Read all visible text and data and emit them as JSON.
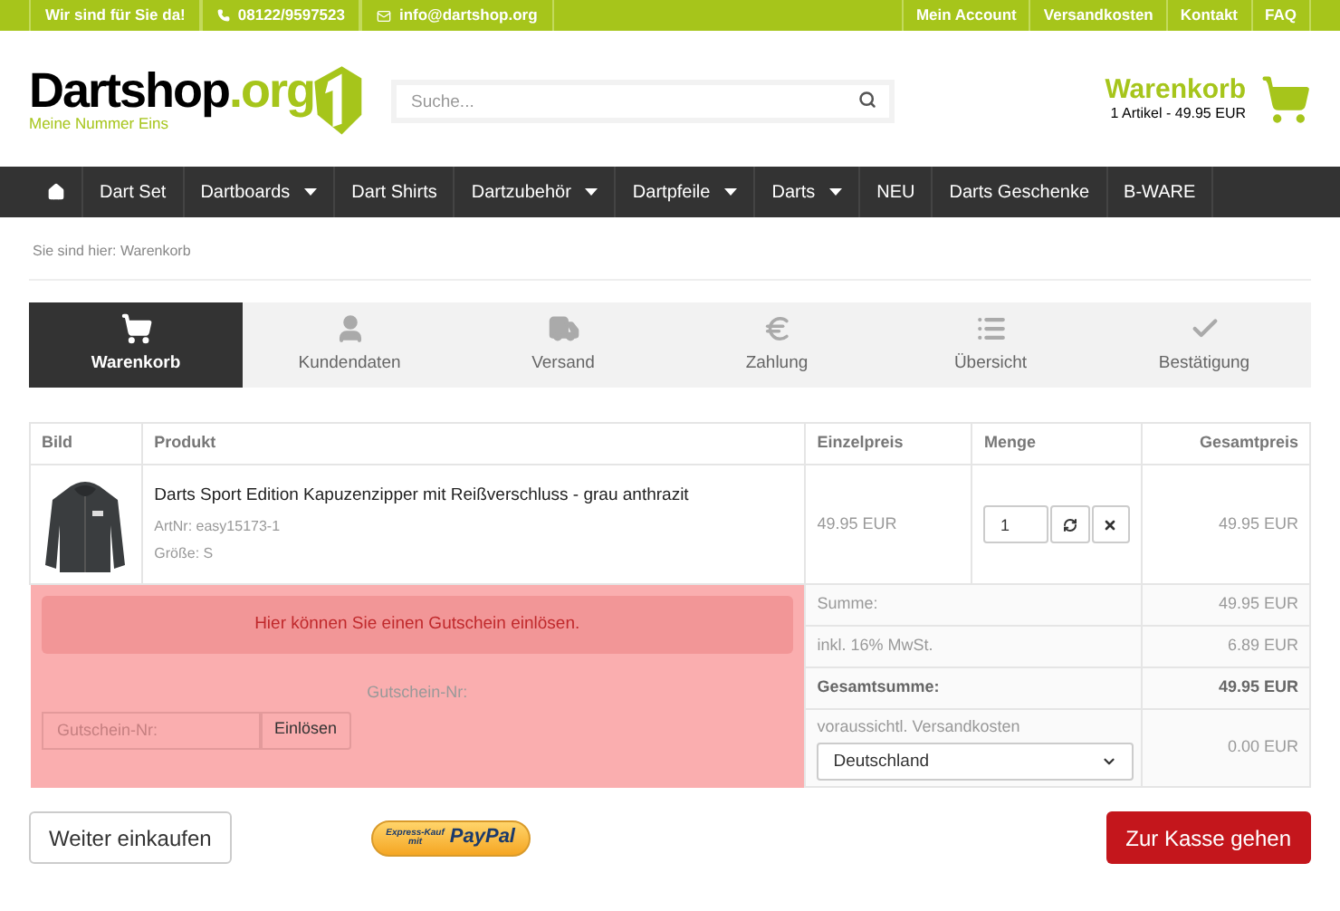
{
  "top_bar": {
    "left": [
      {
        "kind": "plain",
        "label": "Wir sind für Sie da!"
      },
      {
        "kind": "phone",
        "label": "08122/9597523"
      },
      {
        "kind": "email",
        "label": "info@dartshop.org"
      }
    ],
    "right": [
      "Mein Account",
      "Versandkosten",
      "Kontakt",
      "FAQ"
    ]
  },
  "header": {
    "logo": {
      "name": "Dartshop",
      "tld": ".org",
      "slogan": "Meine Nummer Eins"
    },
    "search": {
      "placeholder": "Suche..."
    },
    "cart": {
      "title": "Warenkorb",
      "summary": "1 Artikel - 49.95 EUR"
    }
  },
  "nav": [
    {
      "kind": "home"
    },
    {
      "kind": "link",
      "label": "Dart Set",
      "dropdown": false
    },
    {
      "kind": "link",
      "label": "Dartboards",
      "dropdown": true
    },
    {
      "kind": "link",
      "label": "Dart Shirts",
      "dropdown": false
    },
    {
      "kind": "link",
      "label": "Dartzubehör",
      "dropdown": true
    },
    {
      "kind": "link",
      "label": "Dartpfeile",
      "dropdown": true
    },
    {
      "kind": "link",
      "label": "Darts",
      "dropdown": true
    },
    {
      "kind": "link",
      "label": "NEU",
      "dropdown": false
    },
    {
      "kind": "link",
      "label": "Darts Geschenke",
      "dropdown": false
    },
    {
      "kind": "link",
      "label": "B-WARE",
      "dropdown": false
    }
  ],
  "breadcrumb": "Sie sind hier: Warenkorb",
  "steps": [
    {
      "kind": "cart",
      "label": "Warenkorb",
      "selected": true
    },
    {
      "kind": "user",
      "label": "Kundendaten",
      "selected": false
    },
    {
      "kind": "truck",
      "label": "Versand",
      "selected": false
    },
    {
      "kind": "euro",
      "label": "Zahlung",
      "selected": false
    },
    {
      "kind": "list",
      "label": "Übersicht",
      "selected": false
    },
    {
      "kind": "check",
      "label": "Bestätigung",
      "selected": false
    }
  ],
  "table": {
    "columns": [
      "Bild",
      "Produkt",
      "Einzelpreis",
      "Menge",
      "Gesamtpreis"
    ],
    "rows": [
      {
        "name": "Darts Sport Edition Kapuzenzipper mit Reißverschluss - grau anthrazit",
        "art_nr": "ArtNr: easy15173-1",
        "size": "Größe: S",
        "unit_price": "49.95 EUR",
        "quantity": "1",
        "total": "49.95 EUR"
      }
    ]
  },
  "coupon": {
    "message": "Hier können Sie einen Gutschein einlösen.",
    "label": "Gutschein-Nr:",
    "placeholder": "Gutschein-Nr:",
    "button": "Einlösen"
  },
  "totals": [
    {
      "label": "Summe:",
      "value": "49.95 EUR",
      "bold": false
    },
    {
      "label": "inkl. 16% MwSt.",
      "value": "6.89 EUR",
      "bold": false
    },
    {
      "label": "Gesamtsumme:",
      "value": "49.95 EUR",
      "bold": true
    }
  ],
  "shipping": {
    "label": "voraussichtl. Versandkosten",
    "country": "Deutschland",
    "value": "0.00 EUR"
  },
  "actions": {
    "continue": "Weiter einkaufen",
    "paypal": {
      "top": "Express-Kauf",
      "bottom": "mit",
      "brand": "PayPal"
    },
    "checkout": "Zur Kasse gehen"
  }
}
